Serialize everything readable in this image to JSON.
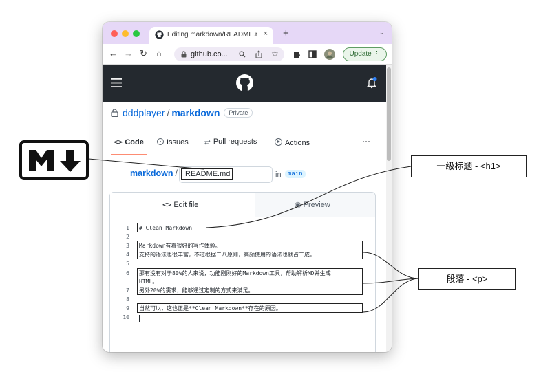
{
  "browser": {
    "tab_title": "Editing markdown/README.md",
    "address": "github.co...",
    "update_label": "Update",
    "new_tab": "+",
    "tab_close": "×"
  },
  "repo": {
    "owner": "dddplayer",
    "separator": "/",
    "name": "markdown",
    "visibility": "Private"
  },
  "nav": {
    "items": [
      {
        "label": "Code",
        "icon": "code-icon"
      },
      {
        "label": "Issues",
        "icon": "issue-icon"
      },
      {
        "label": "Pull requests",
        "icon": "pull-request-icon"
      },
      {
        "label": "Actions",
        "icon": "play-icon"
      }
    ],
    "more": "···"
  },
  "path": {
    "repo": "markdown",
    "separator": "/",
    "filename": "README.md",
    "in_label": "in",
    "branch": "main"
  },
  "editor": {
    "tab_edit": "Edit file",
    "tab_preview": "Preview",
    "lines": [
      {
        "n": "1",
        "text": "# Clean Markdown"
      },
      {
        "n": "2",
        "text": ""
      },
      {
        "n": "3",
        "text": "Markdown有着很好的写作体验。"
      },
      {
        "n": "4",
        "text": "支持的语法也很丰富，不过根据二八原则，高频使用的语法也就占二成。"
      },
      {
        "n": "5",
        "text": ""
      },
      {
        "n": "6",
        "text": "那有没有对于80%的人来说，功能刚刚好的Markdown工具，帮助解析MD并生成"
      },
      {
        "n": "",
        "text": "HTML。"
      },
      {
        "n": "7",
        "text": "另外20%的需求，能够通过定制的方式来满足。"
      },
      {
        "n": "8",
        "text": ""
      },
      {
        "n": "9",
        "text": "当然可以，这也正是**Clean Markdown**存在的原因。"
      },
      {
        "n": "10",
        "text": ""
      }
    ]
  },
  "annotations": {
    "heading": "一级标题 - <h1>",
    "paragraph": "段落 - <p>"
  },
  "colors": {
    "tab_bar": "#e6d8f7",
    "header": "#24292f",
    "link": "#0969da",
    "nav_underline": "#fd8c73",
    "update": "#2e6b34"
  }
}
